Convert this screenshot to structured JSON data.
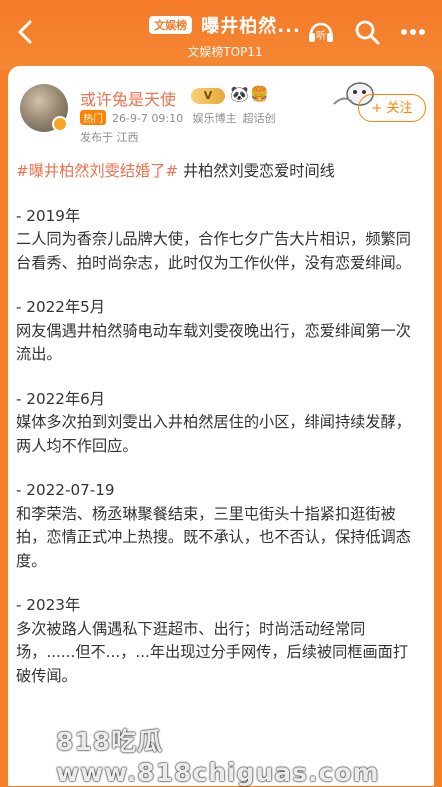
{
  "topbar": {
    "tag": "文娱榜",
    "title": "曝井柏然...",
    "subtitle": "文娱榜TOP11",
    "icons": [
      "back-icon",
      "listen-icon",
      "search-icon",
      "more-icon"
    ],
    "listen_label": "听"
  },
  "post": {
    "username": "或许兔是天使",
    "badge": "V",
    "emojis": [
      "🐼",
      "🍔"
    ],
    "hot_label": "热门",
    "time": "26-9-7 09:10",
    "role": "娱乐博主",
    "topic": "超话创",
    "from": "发布于 江西",
    "follow_label": "+ 关注"
  },
  "content": {
    "hashtag": "#曝井柏然刘雯结婚了#",
    "title_tail": " 井柏然刘雯恋爱时间线",
    "entries": [
      {
        "heading": "- 2019年",
        "text": "二人同为香奈儿品牌大使，合作七夕广告大片相识，频繁同台看秀、拍时尚杂志，此时仅为工作伙伴，没有恋爱绯闻。"
      },
      {
        "heading": "- 2022年5月",
        "text": "网友偶遇井柏然骑电动车载刘雯夜晚出行，恋爱绯闻第一次流出。"
      },
      {
        "heading": "- 2022年6月",
        "text": "媒体多次拍到刘雯出入井柏然居住的小区，绯闻持续发酵，两人均不作回应。"
      },
      {
        "heading": "- 2022-07-19",
        "text": "和李荣浩、杨丞琳聚餐结束，三里屯街头十指紧扣逛街被拍，恋情正式冲上热搜。既不承认，也不否认，保持低调态度。"
      },
      {
        "heading": "- 2023年",
        "text": "多次被路人偶遇私下逛超市、出行；时尚活动经常同场，......但不...，...年出现过分手网传，后续被同框画面打破传闻。"
      }
    ]
  },
  "watermark": {
    "text": "818吃瓜 www.818chiguas.com"
  }
}
